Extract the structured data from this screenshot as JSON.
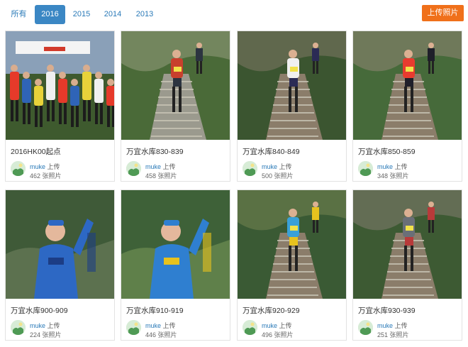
{
  "tabs": [
    {
      "label": "所有",
      "active": false
    },
    {
      "label": "2016",
      "active": true
    },
    {
      "label": "2015",
      "active": false
    },
    {
      "label": "2014",
      "active": false
    },
    {
      "label": "2013",
      "active": false
    }
  ],
  "upload_button": "上传照片",
  "uploaded_suffix": "上传",
  "albums": [
    {
      "title": "2016HK00起点",
      "user": "muke",
      "count": "462 张照片",
      "scene": "start"
    },
    {
      "title": "万宜水库830-839",
      "user": "muke",
      "count": "458 张照片",
      "scene": "stairs"
    },
    {
      "title": "万宜水库840-849",
      "user": "muke",
      "count": "500 张照片",
      "scene": "trail"
    },
    {
      "title": "万宜水库850-859",
      "user": "muke",
      "count": "348 张照片",
      "scene": "trail"
    },
    {
      "title": "万宜水库900-909",
      "user": "muke",
      "count": "224 张照片",
      "scene": "closeup"
    },
    {
      "title": "万宜水库910-919",
      "user": "muke",
      "count": "446 张照片",
      "scene": "closeup"
    },
    {
      "title": "万宜水库920-929",
      "user": "muke",
      "count": "496 张照片",
      "scene": "trail"
    },
    {
      "title": "万宜水库930-939",
      "user": "muke",
      "count": "251 张照片",
      "scene": "trail"
    }
  ],
  "colors": {
    "accent": "#3b87c4",
    "upload": "#f0701a",
    "link": "#2a7ab8"
  }
}
